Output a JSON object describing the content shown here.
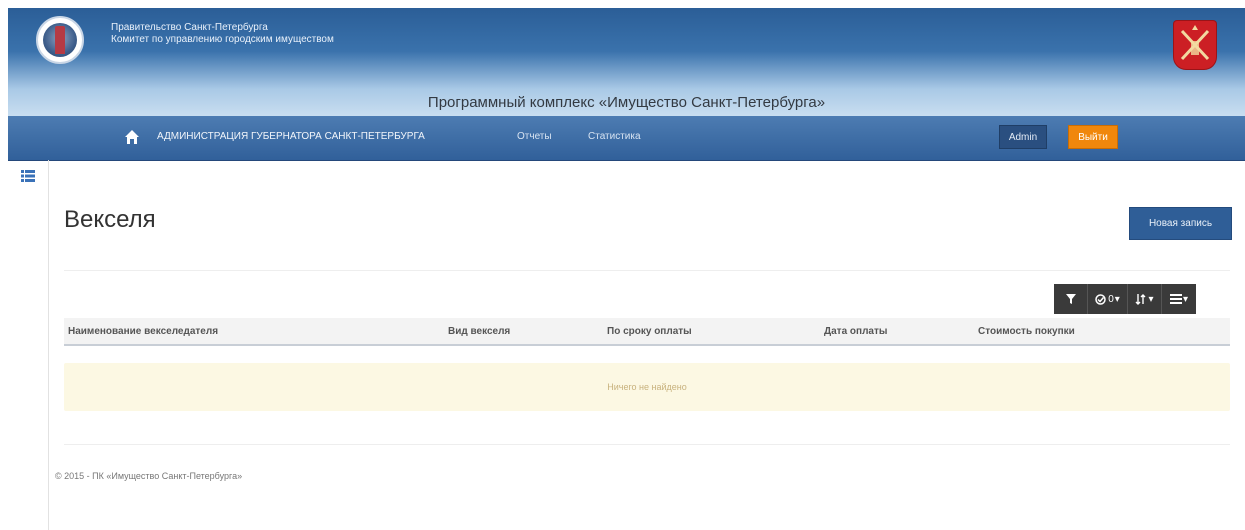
{
  "header": {
    "gov_line1": "Правительство Санкт-Петербурга",
    "gov_line2": "Комитет по управлению городским имуществом",
    "app_title": "Программный комплекс «Имущество Санкт-Петербурга»"
  },
  "nav": {
    "org": "АДМИНИСТРАЦИЯ ГУБЕРНАТОРА САНКТ-ПЕТЕРБУРГА",
    "reports": "Отчеты",
    "stats": "Статистика",
    "admin": "Admin",
    "logout": "Выйти"
  },
  "page": {
    "title": "Векселя",
    "new_record": "Новая запись"
  },
  "toolbar": {
    "check_count": "0"
  },
  "table": {
    "columns": [
      "Наименование векселедателя",
      "Вид векселя",
      "По сроку оплаты",
      "Дата оплаты",
      "Стоимость покупки"
    ],
    "empty_text": "Ничего не найдено"
  },
  "footer": "© 2015 - ПК «Имущество Санкт-Петербурга»",
  "colors": {
    "navbar": "#3a6aa5",
    "logout": "#f0870c",
    "primary": "#2f5e97",
    "empty_row": "#fcf8e3"
  }
}
